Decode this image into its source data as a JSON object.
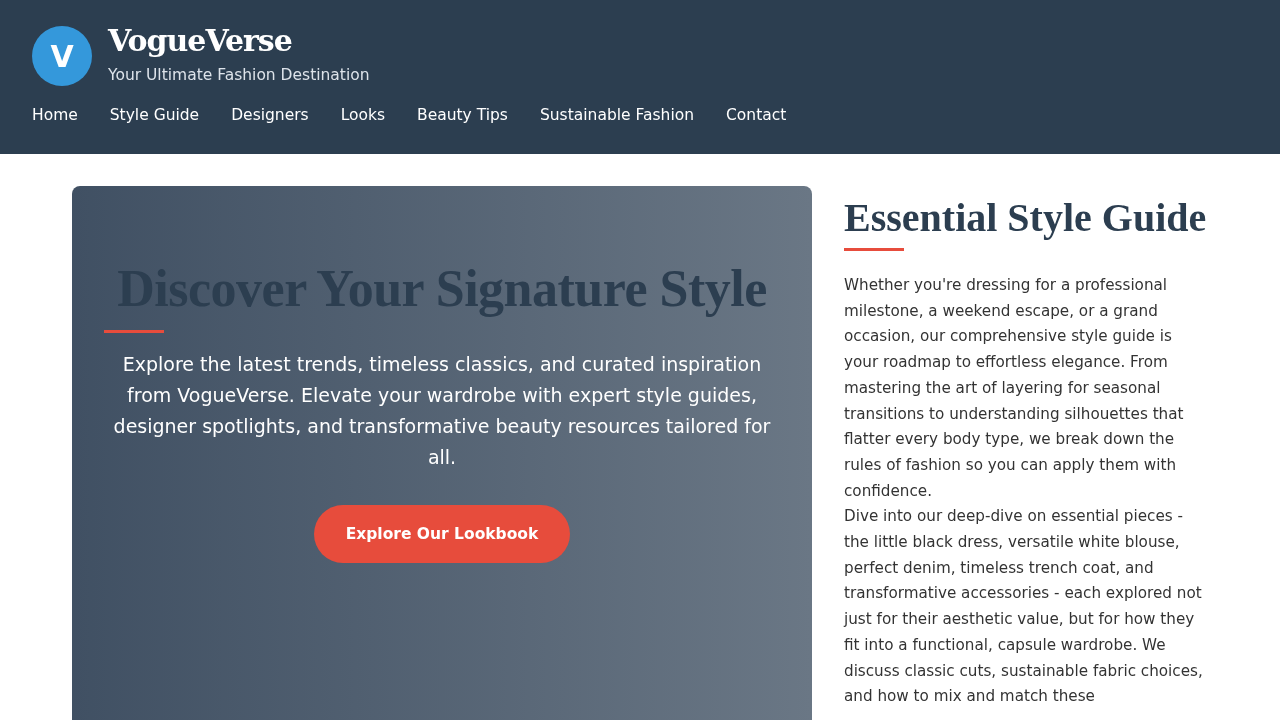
{
  "header": {
    "logo_letter": "V",
    "title": "VogueVerse",
    "tagline": "Your Ultimate Fashion Destination"
  },
  "nav": [
    "Home",
    "Style Guide",
    "Designers",
    "Looks",
    "Beauty Tips",
    "Sustainable Fashion",
    "Contact"
  ],
  "hero": {
    "title": "Discover Your Signature Style",
    "text": "Explore the latest trends, timeless classics, and curated inspiration from VogueVerse. Elevate your wardrobe with expert style guides, designer spotlights, and transformative beauty resources tailored for all.",
    "button": "Explore Our Lookbook"
  },
  "article": {
    "title": "Essential Style Guide",
    "paragraphs": [
      "Whether you're dressing for a professional milestone, a weekend escape, or a grand occasion, our comprehensive style guide is your roadmap to effortless elegance. From mastering the art of layering for seasonal transitions to understanding silhouettes that flatter every body type, we break down the rules of fashion so you can apply them with confidence.",
      "Dive into our deep-dive on essential pieces - the little black dress, versatile white blouse, perfect denim, timeless trench coat, and transformative accessories - each explored not just for their aesthetic value, but for how they fit into a functional, capsule wardrobe. We discuss classic cuts, sustainable fabric choices, and how to mix and match these"
    ]
  }
}
